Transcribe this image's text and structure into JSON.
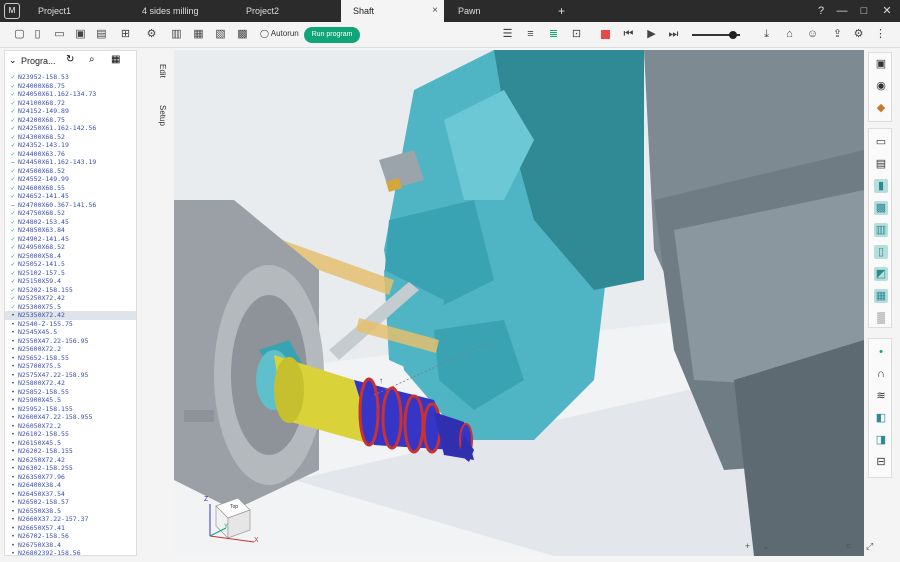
{
  "titlebar": {
    "logo": "M",
    "tabs": [
      {
        "label": "Project1",
        "active": false
      },
      {
        "label": "4 sides milling",
        "active": false
      },
      {
        "label": "Project2",
        "active": false
      },
      {
        "label": "Shaft",
        "active": true
      },
      {
        "label": "Pawn",
        "active": false
      }
    ],
    "close_tab": "×",
    "new_tab": "+",
    "help": "?",
    "minimize": "—",
    "maximize": "□",
    "close": "✕"
  },
  "toolbar": {
    "autorun_label": "Autorun",
    "run_label": "Run program"
  },
  "sidebar": {
    "title": "Progra...",
    "rows": [
      {
        "text": "N23952-158.53",
        "status": "check"
      },
      {
        "text": "N24000X68.75",
        "status": "check"
      },
      {
        "text": "N24050X61.162-134.73",
        "status": "check"
      },
      {
        "text": "N24100X68.72",
        "status": "check"
      },
      {
        "text": "N24152-149.89",
        "status": "check"
      },
      {
        "text": "N24200X68.75",
        "status": "check"
      },
      {
        "text": "N24250X61.162-142.56",
        "status": "check"
      },
      {
        "text": "N24300X68.52",
        "status": "check"
      },
      {
        "text": "N24352-143.19",
        "status": "check"
      },
      {
        "text": "N24400X63.76",
        "status": "check"
      },
      {
        "text": "N24450X61.162-143.19",
        "status": "dash"
      },
      {
        "text": "N24500X68.52",
        "status": "check"
      },
      {
        "text": "N24552-149.99",
        "status": "check"
      },
      {
        "text": "N24600X68.55",
        "status": "check"
      },
      {
        "text": "N24652-141.45",
        "status": "check"
      },
      {
        "text": "N24700X60.367-141.56",
        "status": "dash"
      },
      {
        "text": "N24750X68.52",
        "status": "check"
      },
      {
        "text": "N24802-153.45",
        "status": "check"
      },
      {
        "text": "N24850X63.84",
        "status": "check"
      },
      {
        "text": "N24902-141.45",
        "status": "check"
      },
      {
        "text": "N24950X68.52",
        "status": "check"
      },
      {
        "text": "N25000X58.4",
        "status": "check"
      },
      {
        "text": "N25052-141.5",
        "status": "check"
      },
      {
        "text": "N25102-157.5",
        "status": "check"
      },
      {
        "text": "N25150X59.4",
        "status": "check"
      },
      {
        "text": "N25202-158.155",
        "status": "check"
      },
      {
        "text": "N25250X72.42",
        "status": "check"
      },
      {
        "text": "N25300X75.5",
        "status": "check"
      },
      {
        "text": "N25350X72.42",
        "status": "dot"
      },
      {
        "text": "N2540-Z-155.75",
        "status": "dot"
      },
      {
        "text": "N2545X45.5",
        "status": "dot"
      },
      {
        "text": "N2550X47.22-156.95",
        "status": "dot"
      },
      {
        "text": "N25600X72.2",
        "status": "dot"
      },
      {
        "text": "N25652-158.55",
        "status": "dot"
      },
      {
        "text": "N25700X75.5",
        "status": "dot"
      },
      {
        "text": "N2575X47.22-158.95",
        "status": "dot"
      },
      {
        "text": "N25800X72.42",
        "status": "dot"
      },
      {
        "text": "N25852-158.55",
        "status": "dot"
      },
      {
        "text": "N25900X45.5",
        "status": "dot"
      },
      {
        "text": "N25952-158.155",
        "status": "dot"
      },
      {
        "text": "N2600X47.22-158.955",
        "status": "dot"
      },
      {
        "text": "N26050X72.2",
        "status": "dot"
      },
      {
        "text": "N26102-158.55",
        "status": "dot"
      },
      {
        "text": "N26150X45.5",
        "status": "dot"
      },
      {
        "text": "N26202-158.155",
        "status": "dot"
      },
      {
        "text": "N26250X72.42",
        "status": "dot"
      },
      {
        "text": "N26302-158.255",
        "status": "dot"
      },
      {
        "text": "N26350X77.96",
        "status": "dot"
      },
      {
        "text": "N26400X38.4",
        "status": "dot"
      },
      {
        "text": "N26450X37.54",
        "status": "dot"
      },
      {
        "text": "N26502-158.57",
        "status": "dot"
      },
      {
        "text": "N26550X38.5",
        "status": "dot"
      },
      {
        "text": "N2660X37.22-157.37",
        "status": "dot"
      },
      {
        "text": "N26650X57.41",
        "status": "dot"
      },
      {
        "text": "N26702-158.56",
        "status": "dot"
      },
      {
        "text": "N26750X38.4",
        "status": "dot"
      },
      {
        "text": "N26802392-158.56",
        "status": "dot"
      }
    ],
    "selected_index": 28
  },
  "vertical_tabs": [
    "Edit",
    "Setup"
  ],
  "viewcube": {
    "face": "Top",
    "x_label": "X",
    "y_label": "Y",
    "z_label": "Z"
  },
  "colors": {
    "accent": "#0fa578",
    "titlebar": "#2b2b2b",
    "machine": "#4fb4c4",
    "part_blue": "#3535c8",
    "part_yellow": "#d9d238",
    "part_red": "#c83232"
  }
}
